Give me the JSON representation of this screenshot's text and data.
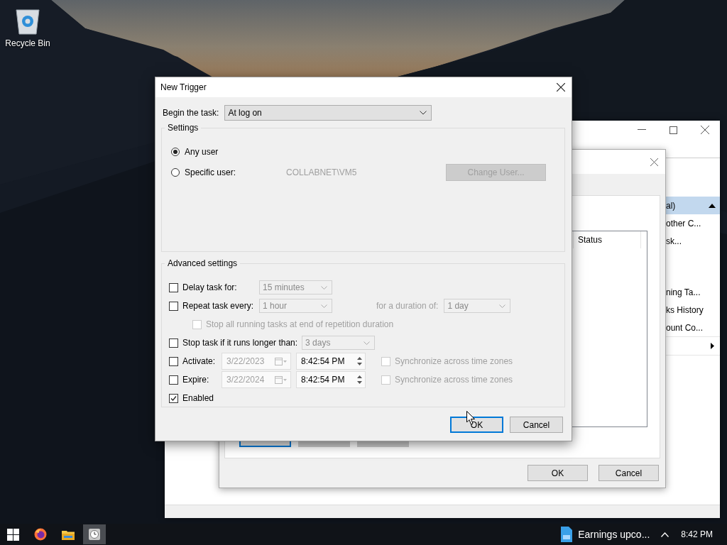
{
  "desktop": {
    "icons": [
      {
        "label": "Recycle Bin"
      }
    ]
  },
  "scheduler_window": {
    "actions": [
      {
        "label": "al)",
        "selected": true
      },
      {
        "label": "other C...",
        "selected": false
      },
      {
        "label": "sk...",
        "selected": false
      },
      {
        "label": "ning Ta...",
        "selected": false
      },
      {
        "label": "ks History",
        "selected": false
      },
      {
        "label": "ount Co...",
        "selected": false
      }
    ]
  },
  "task_dialog": {
    "columns": [
      "Status"
    ],
    "buttons": [
      {
        "label": "OK"
      },
      {
        "label": "Cancel"
      }
    ]
  },
  "trigger_dialog": {
    "title": "New Trigger",
    "begin": {
      "label": "Begin the task:",
      "value": "At log on"
    },
    "settings": {
      "title": "Settings",
      "radios": [
        {
          "label": "Any user",
          "selected": true
        },
        {
          "label": "Specific user:",
          "selected": false
        }
      ],
      "user": "COLLABNET\\VM5",
      "change_user": {
        "label": "Change User...",
        "disabled": true
      }
    },
    "advanced": {
      "title": "Advanced settings",
      "rows": [
        {
          "kind": "dropdown",
          "label": "Delay task for:",
          "checked": false,
          "value": "15 minutes"
        },
        {
          "kind": "repeat",
          "label": "Repeat task every:",
          "checked": false,
          "value": "1 hour",
          "duration_label": "for a duration of:",
          "duration_value": "1 day"
        },
        {
          "kind": "sub",
          "label": "Stop all running tasks at end of repetition duration",
          "checked": false
        },
        {
          "kind": "dropdown",
          "label": "Stop task if it runs longer than:",
          "checked": false,
          "value": "3 days"
        },
        {
          "kind": "datetime",
          "label": "Activate:",
          "checked": false,
          "date": "3/22/2023",
          "time": "8:42:54 PM",
          "sync_label": "Synchronize across time zones",
          "sync_checked": false
        },
        {
          "kind": "datetime",
          "label": "Expire:",
          "checked": false,
          "date": "3/22/2024",
          "time": "8:42:54 PM",
          "sync_label": "Synchronize across time zones",
          "sync_checked": false
        },
        {
          "kind": "check",
          "label": "Enabled",
          "checked": true
        }
      ]
    },
    "buttons": [
      {
        "label": "OK",
        "default": true
      },
      {
        "label": "Cancel",
        "default": false
      }
    ]
  },
  "taskbar": {
    "notification": "Earnings upco...",
    "clock": "8:42 PM"
  }
}
